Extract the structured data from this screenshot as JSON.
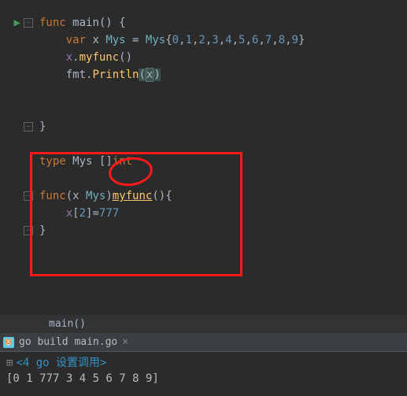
{
  "code": {
    "func": "func",
    "main_name": "main",
    "main_parens": "()",
    "brace_open": "{",
    "brace_close": "}",
    "var": "var",
    "x": "x",
    "mys": "Mys",
    "eq": " = ",
    "lit_open": "{",
    "lit_close": "}",
    "nums": [
      "0",
      "1",
      "2",
      "3",
      "4",
      "5",
      "6",
      "7",
      "8",
      "9"
    ],
    "dot": ".",
    "myfunc": "myfunc",
    "call_parens": "()",
    "fmt": "fmt",
    "println": "Println",
    "lparen": "(",
    "rparen": ")",
    "type": "type",
    "slice_int_bracket": "[]",
    "int": "int",
    "func2_sig_open": "(",
    "func2_sig_close": ")",
    "bracket_open": "[",
    "idx2": "2",
    "bracket_close": "]",
    "assign_eq": "=",
    "val777": "777"
  },
  "breadcrumb": "main()",
  "run_tab": "go build main.go",
  "terminal": {
    "header_prefix": "<4 go ",
    "header_cn": "设置调用>",
    "output": "[0 1 777 3 4 5 6 7 8 9]"
  }
}
